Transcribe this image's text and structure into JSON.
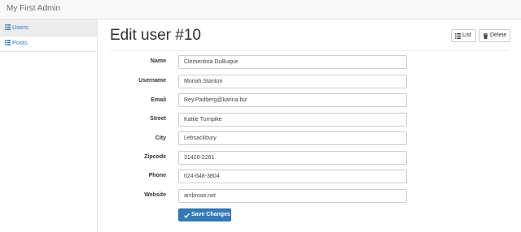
{
  "app": {
    "title": "My First Admin"
  },
  "sidebar": {
    "items": [
      {
        "label": "Users",
        "icon": "list-icon",
        "active": true
      },
      {
        "label": "Posts",
        "icon": "list-icon",
        "active": false
      }
    ]
  },
  "page": {
    "title": "Edit user #10",
    "actions": {
      "list_label": "List",
      "delete_label": "Delete"
    }
  },
  "form": {
    "fields": [
      {
        "label": "Name",
        "value": "Clementina DuBuque"
      },
      {
        "label": "Username",
        "value": "Moriah.Stanton"
      },
      {
        "label": "Email",
        "value": "Rey.Padberg@karina.biz"
      },
      {
        "label": "Street",
        "value": "Kattie Turnpike"
      },
      {
        "label": "City",
        "value": "Lebsackbury"
      },
      {
        "label": "Zipcode",
        "value": "31428-2261"
      },
      {
        "label": "Phone",
        "value": "024-648-3804"
      },
      {
        "label": "Website",
        "value": "ambrose.net"
      }
    ],
    "submit_label": "Save Changes"
  },
  "colors": {
    "accent": "#337ab7",
    "link": "#337ab7"
  }
}
